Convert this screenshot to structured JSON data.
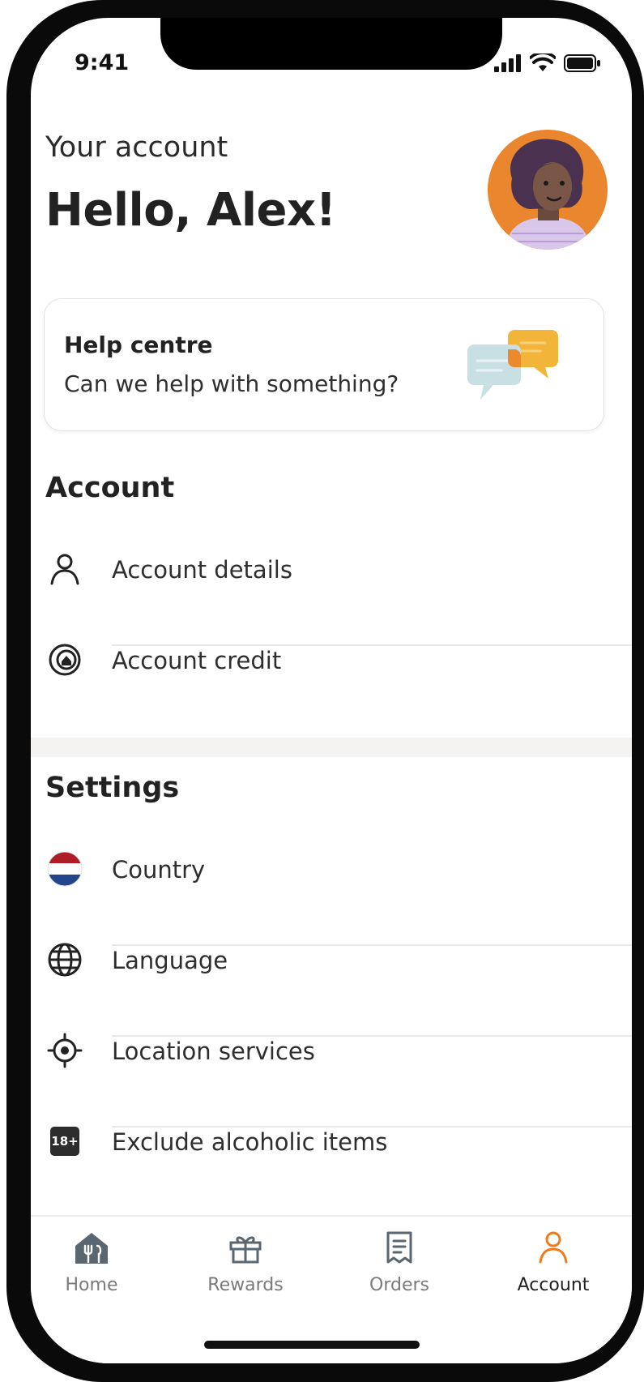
{
  "status": {
    "time": "9:41",
    "icons": [
      "signal-icon",
      "wifi-icon",
      "battery-icon"
    ]
  },
  "header": {
    "eyebrow": "Your account",
    "greeting": "Hello, Alex!"
  },
  "help_card": {
    "title": "Help centre",
    "subtitle": "Can we help with something?"
  },
  "account_section": {
    "heading": "Account",
    "items": [
      {
        "label": "Account details",
        "icon": "person-icon"
      },
      {
        "label": "Account credit",
        "icon": "credit-icon"
      }
    ]
  },
  "settings_section": {
    "heading": "Settings",
    "items": [
      {
        "label": "Country",
        "icon": "netherlands-flag-icon"
      },
      {
        "label": "Language",
        "icon": "globe-icon"
      },
      {
        "label": "Location services",
        "icon": "location-target-icon"
      },
      {
        "label": "Exclude alcoholic items",
        "icon": "age-18-plus-icon",
        "badge": "18+"
      }
    ]
  },
  "tabbar": {
    "tabs": [
      {
        "label": "Home",
        "icon": "home-icon",
        "active": false
      },
      {
        "label": "Rewards",
        "icon": "gift-icon",
        "active": false
      },
      {
        "label": "Orders",
        "icon": "receipt-icon",
        "active": false
      },
      {
        "label": "Account",
        "icon": "person-icon",
        "active": true
      }
    ]
  },
  "colors": {
    "accent": "#f27a1a",
    "avatar_bg": "#e9862e",
    "text": "#222222",
    "muted": "#7a7a7a"
  }
}
